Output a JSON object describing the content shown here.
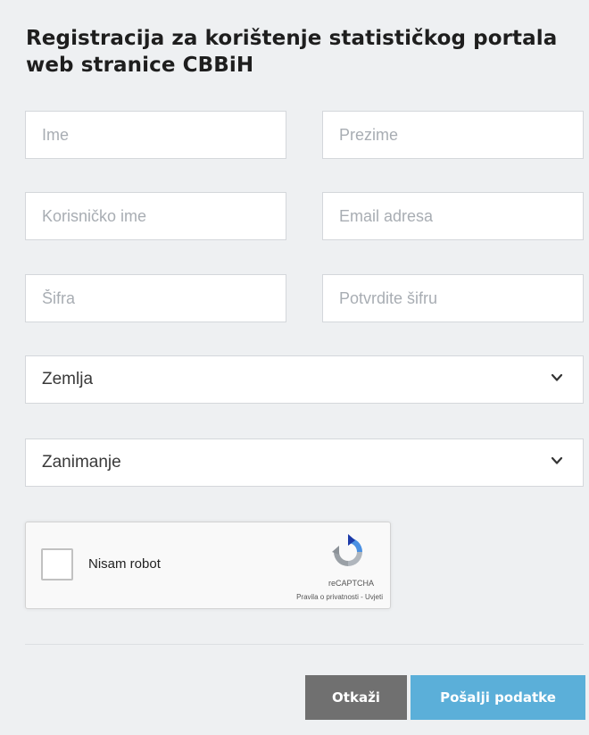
{
  "form": {
    "title": "Registracija za korištenje statističkog portala web stranice CBBiH",
    "fields": {
      "first_name": {
        "placeholder": "Ime"
      },
      "last_name": {
        "placeholder": "Prezime"
      },
      "username": {
        "placeholder": "Korisničko ime"
      },
      "email": {
        "placeholder": "Email adresa"
      },
      "password": {
        "placeholder": "Šifra"
      },
      "password_confirm": {
        "placeholder": "Potvrdite šifru"
      }
    },
    "selects": {
      "country": {
        "label": "Zemlja"
      },
      "occupation": {
        "label": "Zanimanje"
      }
    },
    "captcha": {
      "label": "Nisam robot",
      "brand": "reCAPTCHA",
      "links": "Pravila o privatnosti - Uvjeti"
    },
    "buttons": {
      "cancel": "Otkaži",
      "submit": "Pošalji podatke"
    }
  },
  "colors": {
    "background": "#eef0f2",
    "cancel_button": "#707070",
    "submit_button": "#5bafd9"
  },
  "icons": {
    "select_arrow": "chevron-down-icon",
    "captcha_logo": "recaptcha-logo-icon"
  }
}
